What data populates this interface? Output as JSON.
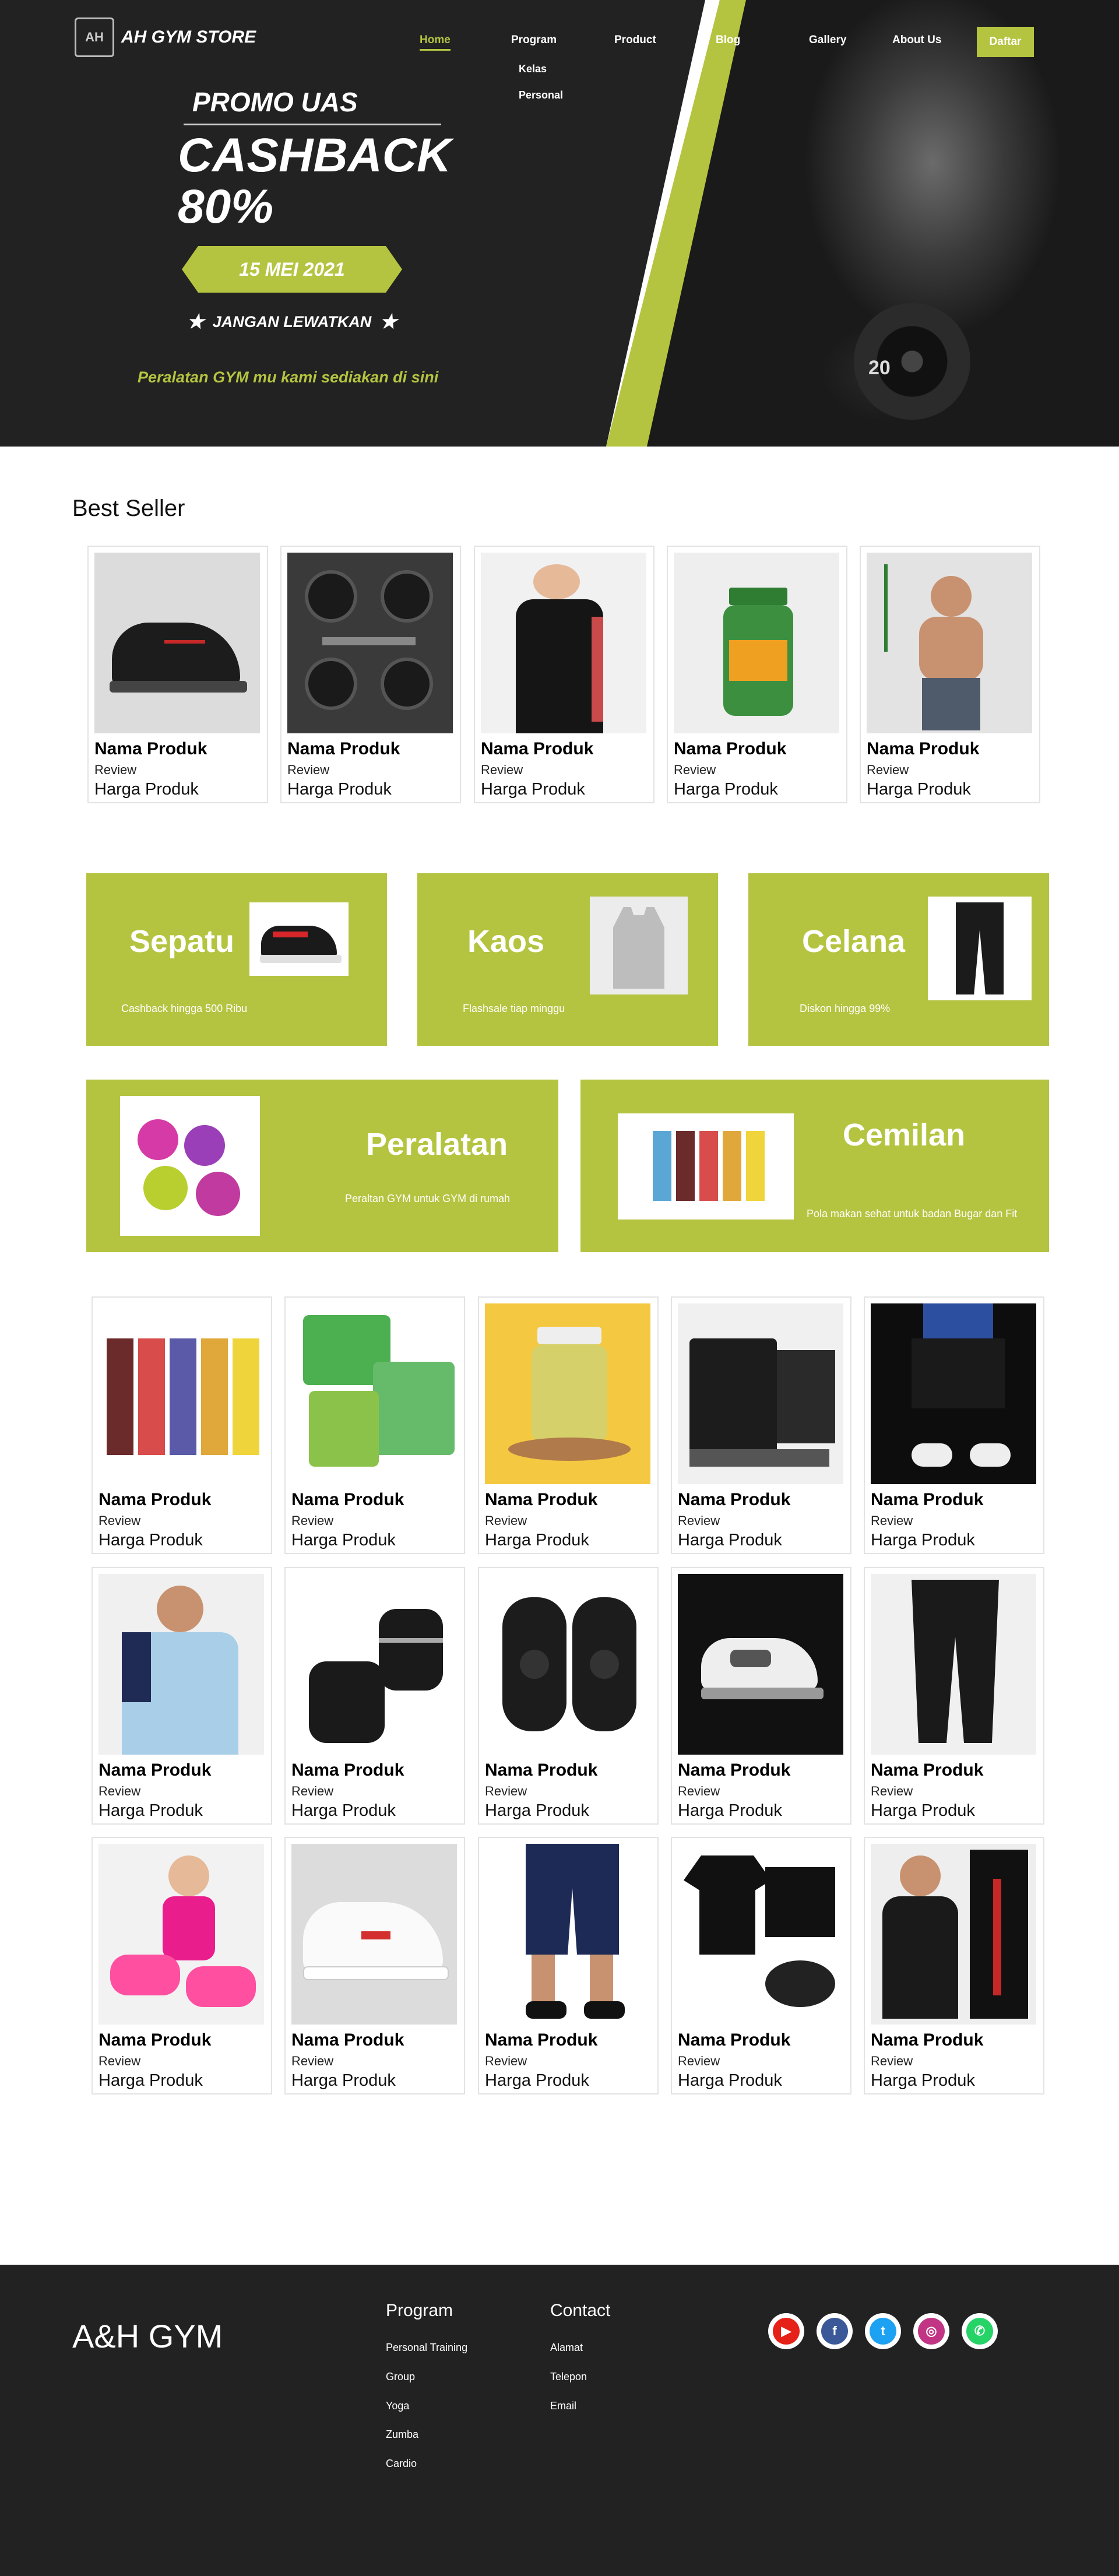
{
  "header": {
    "brand": "AH GYM STORE",
    "logo_mark": "AH",
    "nav": [
      "Home",
      "Program",
      "Product",
      "Blog",
      "Gallery",
      "About Us"
    ],
    "program_submenu": [
      "Kelas",
      "Personal"
    ],
    "signup_label": "Daftar"
  },
  "hero": {
    "promo_line1": "PROMO UAS",
    "promo_line2": "CASHBACK",
    "promo_line3": "80%",
    "date": "15 MEI 2021",
    "cta": "JANGAN LEWATKAN",
    "tagline": "Peralatan GYM mu kami sediakan di sini",
    "plate_text": "20"
  },
  "best_seller": {
    "title": "Best Seller",
    "products": [
      {
        "name": "Nama Produk",
        "review": "Review",
        "price": "Harga Produk",
        "icon": "shoe-icon"
      },
      {
        "name": "Nama Produk",
        "review": "Review",
        "price": "Harga Produk",
        "icon": "dumbbell-set-icon"
      },
      {
        "name": "Nama Produk",
        "review": "Review",
        "price": "Harga Produk",
        "icon": "sweatshirt-icon"
      },
      {
        "name": "Nama Produk",
        "review": "Review",
        "price": "Harga Produk",
        "icon": "vitamin-bottle-icon"
      },
      {
        "name": "Nama Produk",
        "review": "Review",
        "price": "Harga Produk",
        "icon": "resistance-band-icon"
      }
    ]
  },
  "categories": [
    {
      "title": "Sepatu",
      "subtitle": "Cashback hingga 500 Ribu",
      "icon": "sneaker-icon"
    },
    {
      "title": "Kaos",
      "subtitle": "Flashsale tiap minggu",
      "icon": "tank-top-icon"
    },
    {
      "title": "Celana",
      "subtitle": "Diskon hingga 99%",
      "icon": "pants-icon"
    },
    {
      "title": "Peralatan",
      "subtitle": "Peraltan GYM untuk GYM di rumah",
      "icon": "dumbbells-icon"
    },
    {
      "title": "Cemilan",
      "subtitle": "Pola makan sehat untuk badan Bugar dan Fit",
      "icon": "snack-bars-icon"
    }
  ],
  "catalog": {
    "products": [
      {
        "name": "Nama Produk",
        "review": "Review",
        "price": "Harga Produk",
        "icon": "snack-bars-icon"
      },
      {
        "name": "Nama Produk",
        "review": "Review",
        "price": "Harga Produk",
        "icon": "chips-pack-icon"
      },
      {
        "name": "Nama Produk",
        "review": "Review",
        "price": "Harga Produk",
        "icon": "jar-icon"
      },
      {
        "name": "Nama Produk",
        "review": "Review",
        "price": "Harga Produk",
        "icon": "supplement-bag-icon"
      },
      {
        "name": "Nama Produk",
        "review": "Review",
        "price": "Harga Produk",
        "icon": "shorts-model-icon"
      },
      {
        "name": "Nama Produk",
        "review": "Review",
        "price": "Harga Produk",
        "icon": "polo-shirt-icon"
      },
      {
        "name": "Nama Produk",
        "review": "Review",
        "price": "Harga Produk",
        "icon": "gym-gloves-icon"
      },
      {
        "name": "Nama Produk",
        "review": "Review",
        "price": "Harga Produk",
        "icon": "knee-sleeve-icon"
      },
      {
        "name": "Nama Produk",
        "review": "Review",
        "price": "Harga Produk",
        "icon": "sneaker-icon"
      },
      {
        "name": "Nama Produk",
        "review": "Review",
        "price": "Harga Produk",
        "icon": "joggers-icon"
      },
      {
        "name": "Nama Produk",
        "review": "Review",
        "price": "Harga Produk",
        "icon": "pink-dumbbells-icon"
      },
      {
        "name": "Nama Produk",
        "review": "Review",
        "price": "Harga Produk",
        "icon": "white-sneaker-icon"
      },
      {
        "name": "Nama Produk",
        "review": "Review",
        "price": "Harga Produk",
        "icon": "shorts-icon"
      },
      {
        "name": "Nama Produk",
        "review": "Review",
        "price": "Harga Produk",
        "icon": "tshirt-shorts-icon"
      },
      {
        "name": "Nama Produk",
        "review": "Review",
        "price": "Harga Produk",
        "icon": "tshirt-model-icon"
      }
    ]
  },
  "footer": {
    "brand": "A&H GYM",
    "program_title": "Program",
    "program_links": [
      "Personal Training",
      "Group",
      "Yoga",
      "Zumba",
      "Cardio"
    ],
    "contact_title": "Contact",
    "contact_links": [
      "Alamat",
      "Telepon",
      "Email"
    ],
    "social": [
      {
        "icon": "youtube-icon",
        "glyph": "▶",
        "color": "#e62117"
      },
      {
        "icon": "facebook-icon",
        "glyph": "f",
        "color": "#3b5998"
      },
      {
        "icon": "twitter-icon",
        "glyph": "t",
        "color": "#1da1f2"
      },
      {
        "icon": "instagram-icon",
        "glyph": "◎",
        "color": "#c13584"
      },
      {
        "icon": "whatsapp-icon",
        "glyph": "✆",
        "color": "#25d366"
      }
    ]
  },
  "colors": {
    "accent": "#b5c440",
    "dark": "#222222"
  }
}
